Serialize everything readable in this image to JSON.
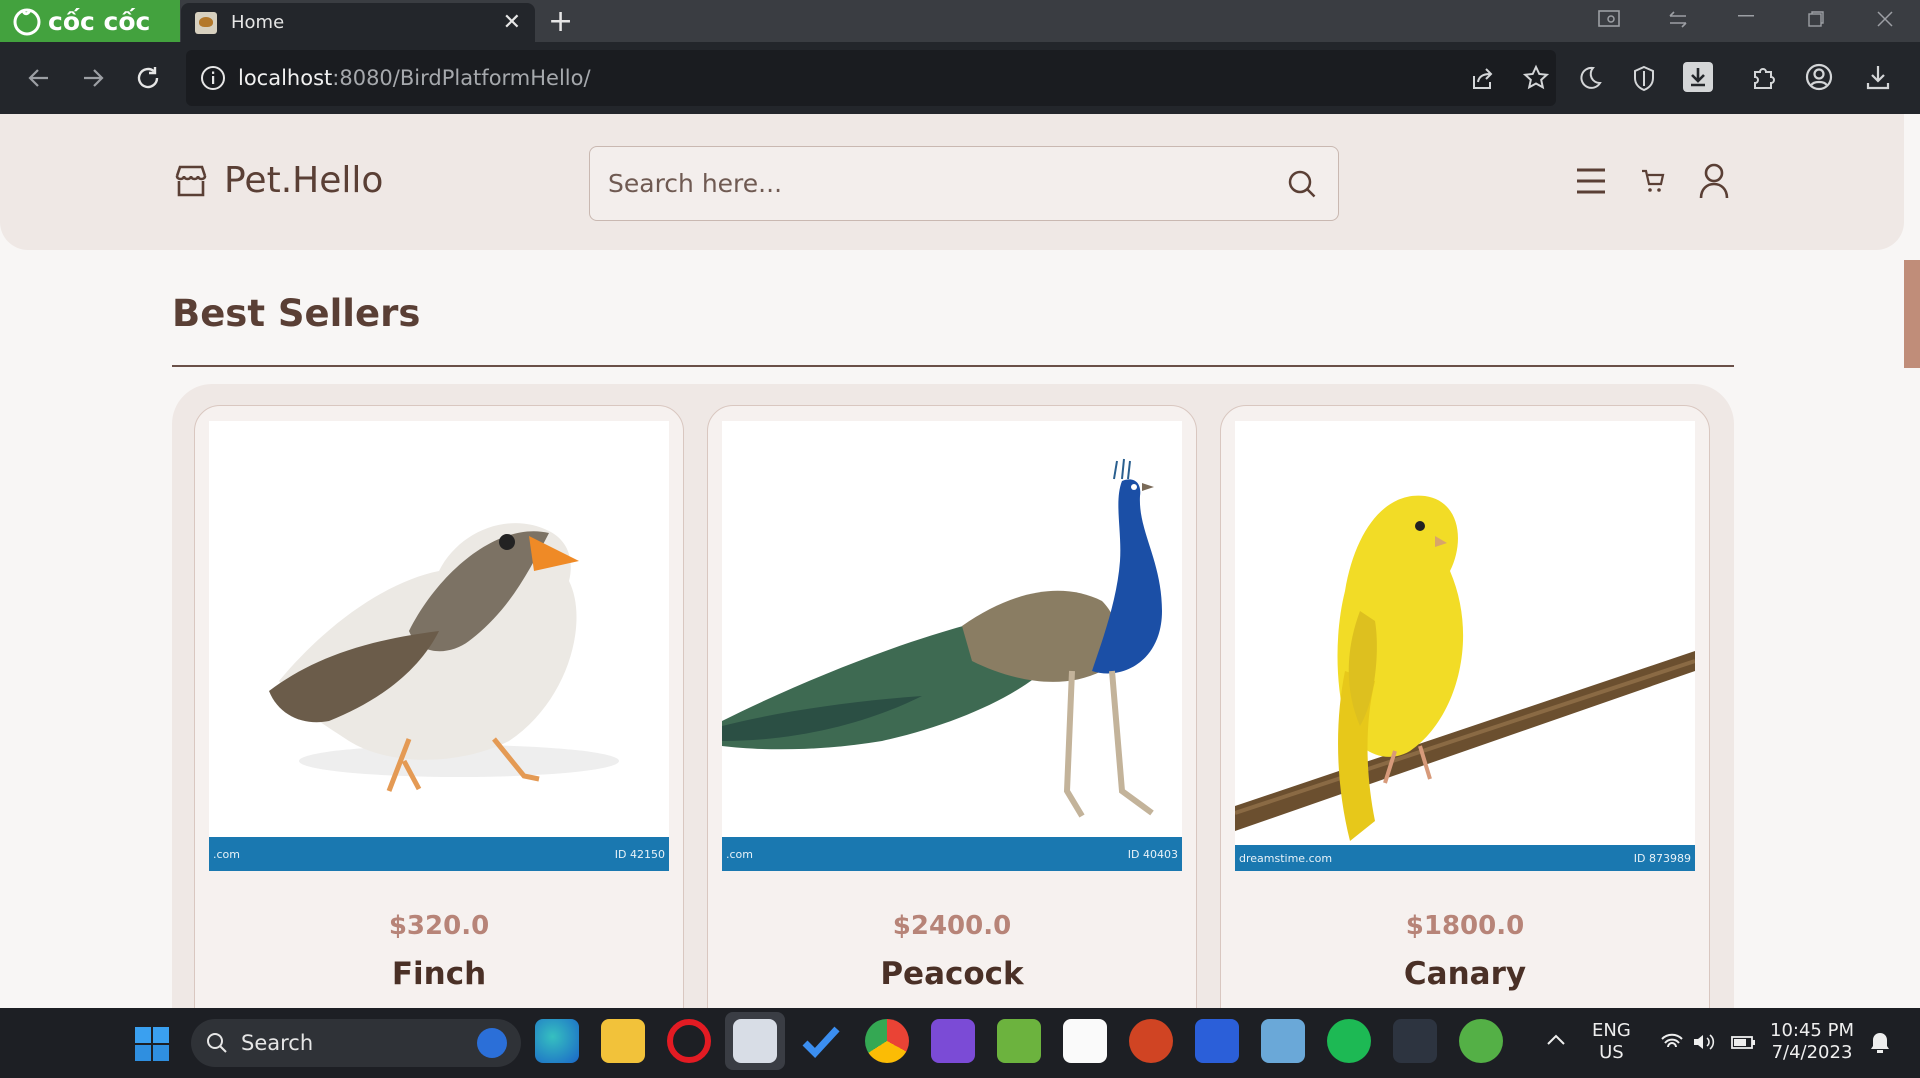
{
  "browser": {
    "brand_name": "cốc cốc",
    "tab_title": "Home",
    "address_host": "localhost",
    "address_path": ":8080/BirdPlatformHello/"
  },
  "site": {
    "brand": "Pet.Hello",
    "search_placeholder": "Search here..."
  },
  "section": {
    "title": "Best Sellers"
  },
  "products": [
    {
      "name": "Finch",
      "price": "$320.0",
      "watermark_left": ".com",
      "watermark_right": "ID 42150"
    },
    {
      "name": "Peacock",
      "price": "$2400.0",
      "watermark_left": ".com",
      "watermark_right": "ID 40403"
    },
    {
      "name": "Canary",
      "price": "$1800.0",
      "watermark_left": "dreamstime.com",
      "watermark_right": "ID 873989"
    }
  ],
  "taskbar": {
    "search_label": "Search",
    "lang": "ENG",
    "region": "US",
    "time": "10:45 PM",
    "date": "7/4/2023"
  },
  "colors": {
    "accent_brown": "#5a3f35",
    "header_bg": "#efe8e5",
    "price_color": "#b78478",
    "browser_dark": "#23262b",
    "coccoc_green": "#43a23e"
  }
}
